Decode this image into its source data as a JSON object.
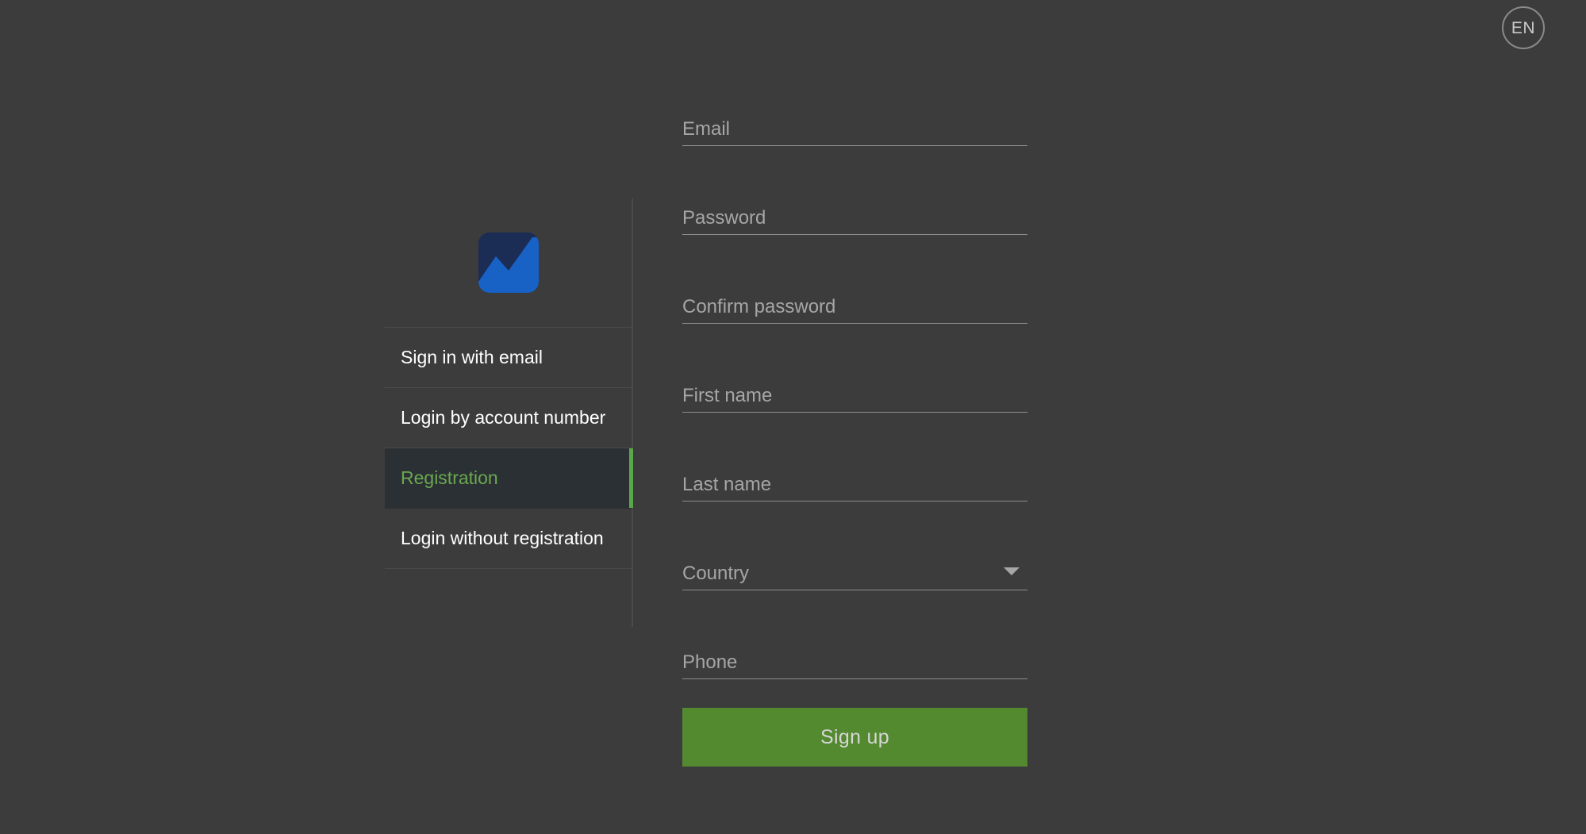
{
  "theme": {
    "background": "#3c3c3c",
    "accent_green": "#6aa84f",
    "indicator_green": "#5aa64b",
    "button_green": "#53892f",
    "active_item_background": "#2b3035",
    "divider": "#4a4a4a",
    "field_underline": "#8d8d8d",
    "placeholder_text": "#a6a6a6",
    "menu_text": "#ffffff",
    "logo_dark_blue": "#1b2d55",
    "logo_bright_blue": "#1862c6"
  },
  "header": {
    "language_button": {
      "label": "EN",
      "icon": "language-circle-icon"
    }
  },
  "sidebar": {
    "logo": {
      "icon": "chart-logo-icon"
    },
    "items": [
      {
        "label": "Sign in with email",
        "active": false
      },
      {
        "label": "Login by account number",
        "active": false
      },
      {
        "label": "Registration",
        "active": true
      },
      {
        "label": "Login without registration",
        "active": false
      }
    ]
  },
  "form": {
    "fields": [
      {
        "label": "Email",
        "value": "",
        "type": "email"
      },
      {
        "label": "Password",
        "value": "",
        "type": "password"
      },
      {
        "label": "Confirm password",
        "value": "",
        "type": "password"
      },
      {
        "label": "First name",
        "value": "",
        "type": "text"
      },
      {
        "label": "Last name",
        "value": "",
        "type": "text"
      },
      {
        "label": "Country",
        "value": "",
        "type": "select",
        "icon": "chevron-down-icon"
      },
      {
        "label": "Phone",
        "value": "",
        "type": "tel"
      }
    ],
    "submit": {
      "label": "Sign up"
    }
  }
}
